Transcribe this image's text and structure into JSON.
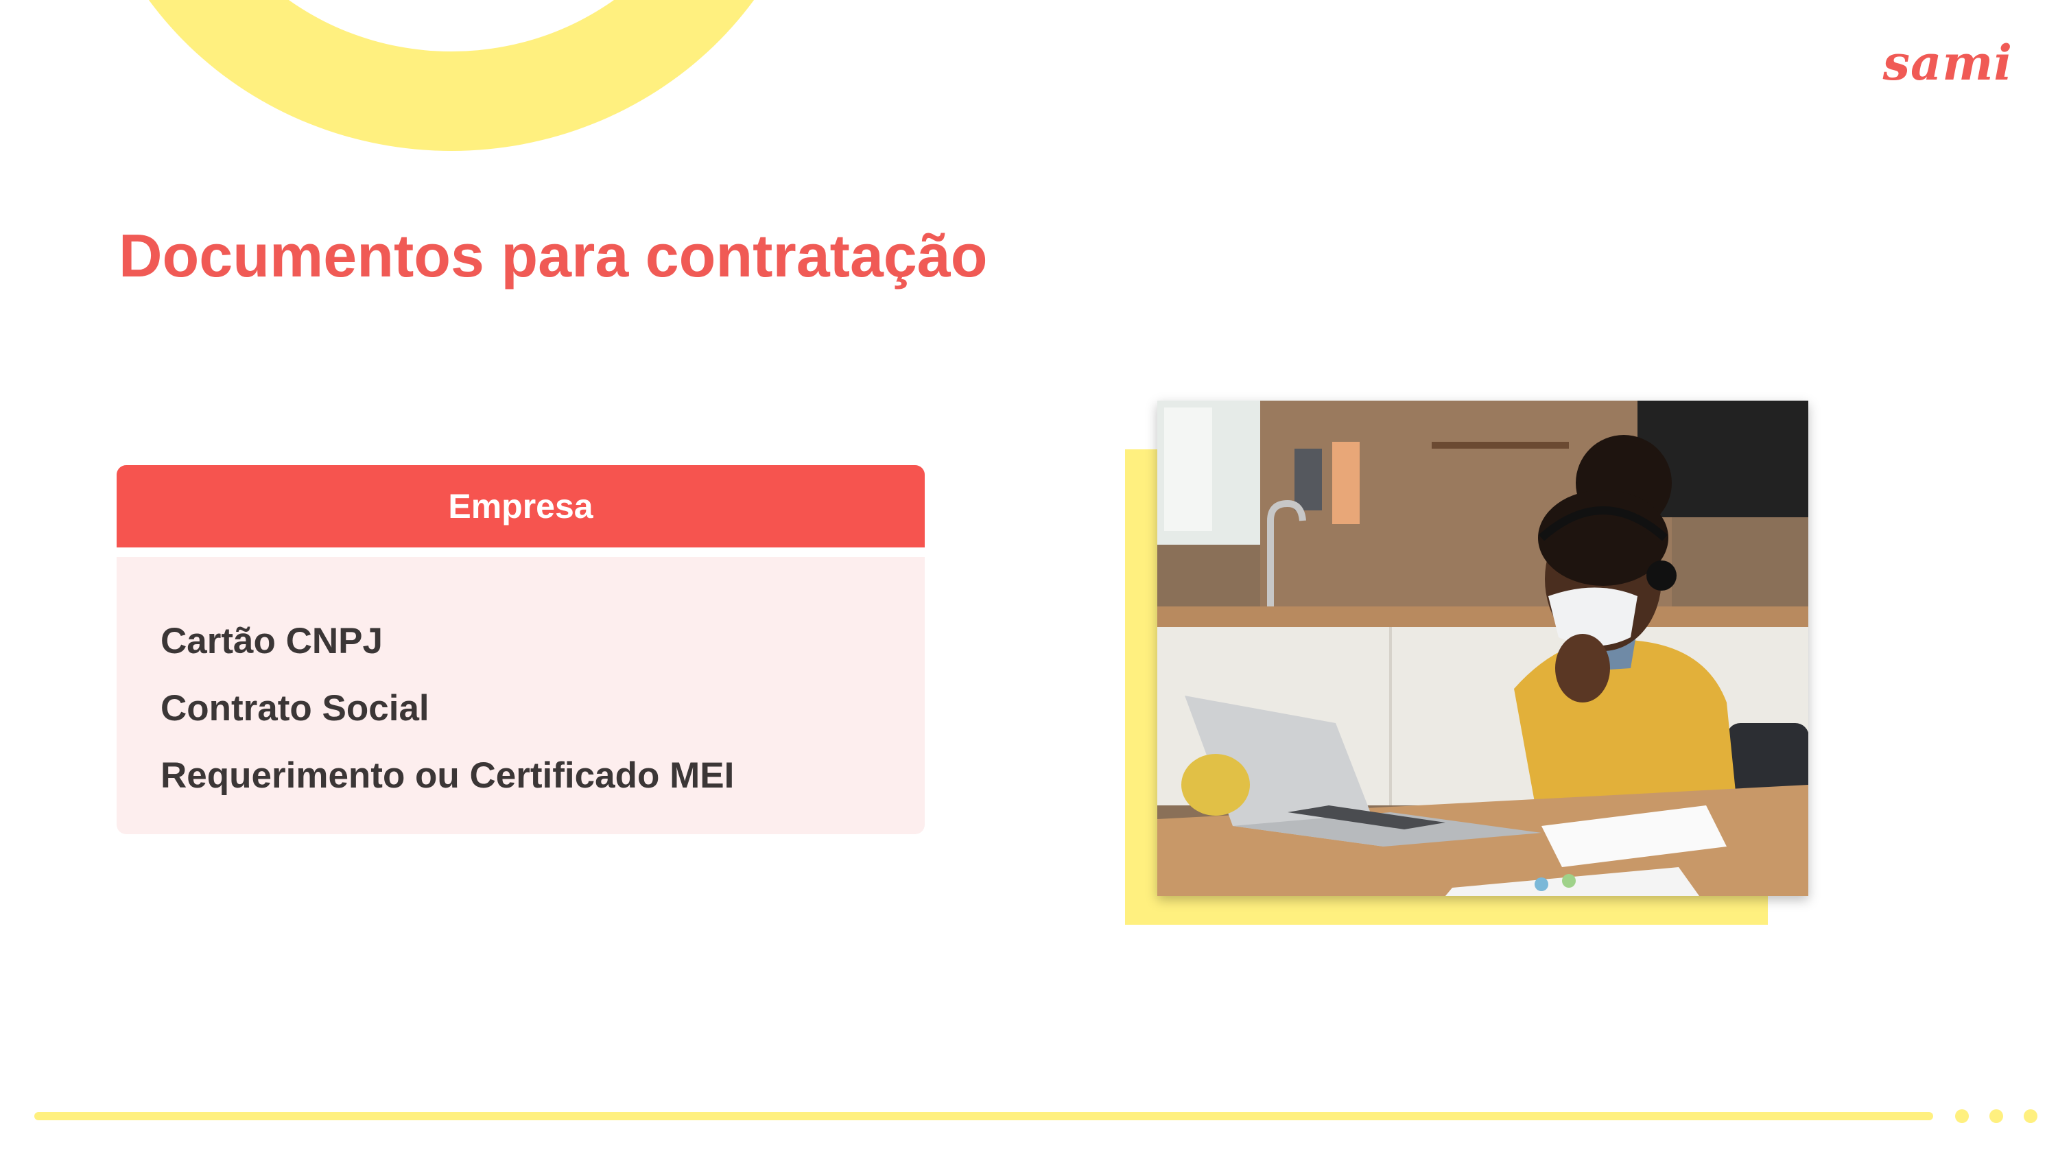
{
  "brand": {
    "logo_text": "sami"
  },
  "title": "Documentos para contratação",
  "card": {
    "header": "Empresa",
    "items": [
      {
        "label": "Cartão CNPJ"
      },
      {
        "label": "Contrato Social"
      },
      {
        "label": "Requerimento ou Certificado MEI"
      }
    ]
  },
  "colors": {
    "accent_red": "#f05a55",
    "header_red": "#f6544f",
    "accent_yellow": "#fff07f",
    "card_bg": "#fdeeee",
    "text_dark": "#3b3636"
  }
}
